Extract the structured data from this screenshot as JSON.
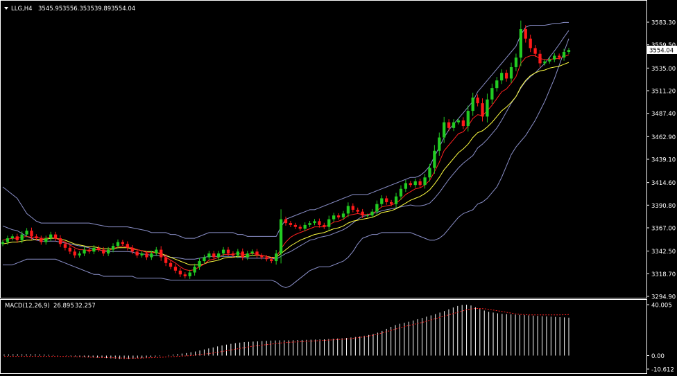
{
  "header": {
    "symbol_timeframe": "LLG,H4",
    "open": "3545.95",
    "high": "3556.35",
    "low": "3539.89",
    "close": "3554.04"
  },
  "macd_header": {
    "label": "MACD(12,26,9)",
    "main": "26.895",
    "signal": "32.257"
  },
  "current_price_label": "3554.04",
  "colors": {
    "background": "#000000",
    "bull_candle": "#22cc22",
    "bear_candle": "#ff1a1a",
    "bollinger": "#8a8fc8",
    "ma_fast": "#ff2020",
    "ma_slow": "#ffff40",
    "macd_hist": "#ffffff",
    "macd_signal": "#ff2020",
    "axis_text": "#ffffff"
  },
  "chart_data": [
    {
      "type": "candlestick",
      "title": "",
      "y_ticks": [
        "3583.30",
        "3559.50",
        "3535.00",
        "3511.20",
        "3487.40",
        "3462.90",
        "3439.10",
        "3414.60",
        "3390.80",
        "3367.00",
        "3342.50",
        "3318.70",
        "3294.90"
      ],
      "ylim": [
        3294.9,
        3583.3
      ],
      "close": [
        3352,
        3356,
        3358,
        3354,
        3360,
        3364,
        3358,
        3356,
        3352,
        3356,
        3360,
        3356,
        3350,
        3346,
        3342,
        3338,
        3340,
        3344,
        3342,
        3346,
        3344,
        3340,
        3344,
        3348,
        3352,
        3350,
        3346,
        3342,
        3338,
        3340,
        3336,
        3340,
        3344,
        3336,
        3330,
        3326,
        3322,
        3318,
        3316,
        3320,
        3326,
        3332,
        3336,
        3340,
        3336,
        3340,
        3344,
        3340,
        3338,
        3342,
        3336,
        3340,
        3342,
        3338,
        3336,
        3334,
        3332,
        3340,
        3376,
        3372,
        3370,
        3368,
        3366,
        3370,
        3372,
        3374,
        3370,
        3368,
        3376,
        3380,
        3378,
        3382,
        3390,
        3386,
        3384,
        3380,
        3380,
        3384,
        3392,
        3398,
        3394,
        3392,
        3400,
        3408,
        3414,
        3412,
        3416,
        3412,
        3420,
        3430,
        3448,
        3462,
        3478,
        3472,
        3478,
        3480,
        3474,
        3490,
        3504,
        3498,
        3484,
        3502,
        3514,
        3522,
        3530,
        3524,
        3536,
        3546,
        3576,
        3566,
        3556,
        3550,
        3540,
        3542,
        3544,
        3548,
        3546,
        3552,
        3554
      ],
      "ma_fast": [
        3354,
        3355,
        3356,
        3356,
        3357,
        3358,
        3357,
        3357,
        3356,
        3356,
        3357,
        3356,
        3354,
        3352,
        3349,
        3346,
        3344,
        3344,
        3343,
        3344,
        3344,
        3343,
        3343,
        3345,
        3347,
        3348,
        3347,
        3346,
        3344,
        3343,
        3341,
        3341,
        3341,
        3339,
        3336,
        3333,
        3330,
        3326,
        3323,
        3322,
        3323,
        3326,
        3329,
        3333,
        3334,
        3336,
        3339,
        3339,
        3339,
        3340,
        3339,
        3339,
        3340,
        3339,
        3338,
        3337,
        3335,
        3336,
        3345,
        3352,
        3357,
        3360,
        3362,
        3364,
        3366,
        3368,
        3368,
        3368,
        3370,
        3373,
        3374,
        3376,
        3380,
        3381,
        3382,
        3381,
        3381,
        3382,
        3385,
        3389,
        3390,
        3391,
        3393,
        3397,
        3402,
        3405,
        3408,
        3409,
        3412,
        3417,
        3426,
        3436,
        3448,
        3454,
        3460,
        3466,
        3468,
        3474,
        3482,
        3486,
        3485,
        3490,
        3496,
        3503,
        3510,
        3513,
        3519,
        3526,
        3540,
        3546,
        3548,
        3548,
        3545,
        3544,
        3544,
        3545,
        3545,
        3547,
        3549
      ],
      "ma_slow": [
        3350,
        3351,
        3352,
        3352,
        3353,
        3354,
        3354,
        3355,
        3355,
        3355,
        3356,
        3356,
        3355,
        3354,
        3352,
        3350,
        3349,
        3348,
        3347,
        3347,
        3346,
        3345,
        3345,
        3345,
        3346,
        3346,
        3346,
        3345,
        3344,
        3343,
        3342,
        3342,
        3341,
        3340,
        3338,
        3336,
        3334,
        3332,
        3330,
        3328,
        3328,
        3328,
        3329,
        3331,
        3332,
        3333,
        3335,
        3336,
        3336,
        3337,
        3337,
        3337,
        3338,
        3338,
        3338,
        3337,
        3336,
        3336,
        3340,
        3344,
        3348,
        3351,
        3354,
        3356,
        3358,
        3360,
        3361,
        3362,
        3364,
        3366,
        3367,
        3369,
        3372,
        3374,
        3375,
        3376,
        3377,
        3378,
        3380,
        3383,
        3384,
        3385,
        3387,
        3390,
        3393,
        3396,
        3398,
        3400,
        3403,
        3407,
        3413,
        3420,
        3428,
        3434,
        3440,
        3446,
        3450,
        3455,
        3462,
        3467,
        3469,
        3473,
        3478,
        3484,
        3490,
        3494,
        3499,
        3505,
        3515,
        3522,
        3527,
        3530,
        3532,
        3533,
        3535,
        3536,
        3537,
        3539,
        3541
      ],
      "bb_upper": [
        3410,
        3406,
        3402,
        3398,
        3390,
        3382,
        3378,
        3374,
        3372,
        3372,
        3372,
        3372,
        3372,
        3372,
        3372,
        3372,
        3372,
        3372,
        3372,
        3371,
        3370,
        3369,
        3368,
        3368,
        3368,
        3368,
        3368,
        3367,
        3366,
        3365,
        3364,
        3362,
        3362,
        3362,
        3362,
        3360,
        3360,
        3358,
        3356,
        3356,
        3356,
        3358,
        3360,
        3362,
        3362,
        3362,
        3362,
        3362,
        3362,
        3360,
        3360,
        3358,
        3358,
        3358,
        3358,
        3358,
        3358,
        3358,
        3368,
        3376,
        3378,
        3380,
        3382,
        3384,
        3386,
        3386,
        3388,
        3390,
        3392,
        3394,
        3396,
        3398,
        3400,
        3402,
        3402,
        3402,
        3402,
        3404,
        3406,
        3408,
        3410,
        3412,
        3414,
        3416,
        3418,
        3420,
        3420,
        3422,
        3426,
        3432,
        3442,
        3452,
        3462,
        3470,
        3476,
        3482,
        3488,
        3494,
        3500,
        3510,
        3516,
        3522,
        3528,
        3534,
        3540,
        3546,
        3552,
        3558,
        3570,
        3578,
        3580,
        3580,
        3580,
        3580,
        3581,
        3582,
        3582,
        3583,
        3583
      ],
      "bb_lower": [
        3328,
        3328,
        3328,
        3330,
        3332,
        3334,
        3334,
        3334,
        3334,
        3334,
        3334,
        3334,
        3332,
        3330,
        3328,
        3326,
        3324,
        3322,
        3320,
        3318,
        3318,
        3316,
        3316,
        3316,
        3316,
        3316,
        3316,
        3316,
        3314,
        3314,
        3314,
        3314,
        3314,
        3314,
        3313,
        3312,
        3312,
        3312,
        3312,
        3312,
        3312,
        3312,
        3312,
        3312,
        3312,
        3312,
        3312,
        3312,
        3312,
        3312,
        3312,
        3312,
        3312,
        3312,
        3312,
        3312,
        3312,
        3310,
        3306,
        3304,
        3306,
        3310,
        3314,
        3318,
        3322,
        3324,
        3326,
        3326,
        3326,
        3328,
        3330,
        3332,
        3336,
        3342,
        3350,
        3356,
        3358,
        3360,
        3360,
        3362,
        3362,
        3362,
        3362,
        3362,
        3362,
        3362,
        3360,
        3358,
        3356,
        3354,
        3354,
        3356,
        3360,
        3366,
        3372,
        3378,
        3382,
        3384,
        3386,
        3392,
        3394,
        3398,
        3404,
        3410,
        3420,
        3432,
        3444,
        3452,
        3458,
        3464,
        3472,
        3480,
        3490,
        3500,
        3512,
        3524,
        3538,
        3552,
        3566
      ]
    },
    {
      "type": "bar",
      "title": "MACD(12,26,9)",
      "y_ticks": [
        "40.005",
        "0.00",
        "-10.612"
      ],
      "ylim": [
        -10.612,
        40.005
      ],
      "series": [
        {
          "name": "MACD",
          "values": [
            0.8,
            0.9,
            1.0,
            1.0,
            1.0,
            1.0,
            1.0,
            1.0,
            0.9,
            0.8,
            0.6,
            0.4,
            0.2,
            0.0,
            -0.2,
            -0.4,
            -0.6,
            -0.8,
            -1.0,
            -1.2,
            -1.4,
            -1.6,
            -1.8,
            -2.0,
            -2.2,
            -2.4,
            -2.6,
            -2.6,
            -2.6,
            -2.4,
            -2.2,
            -2.0,
            -1.6,
            -1.2,
            -0.8,
            -0.4,
            0.0,
            0.4,
            0.8,
            1.2,
            1.6,
            2.0,
            2.6,
            3.2,
            4.0,
            4.8,
            5.6,
            6.4,
            7.2,
            8.0,
            8.6,
            9.2,
            9.8,
            10.2,
            10.6,
            10.8,
            11.0,
            11.2,
            11.4,
            11.6,
            11.8,
            11.9,
            12.0,
            12.0,
            12.0,
            12.1,
            12.2,
            12.3,
            12.4,
            12.5,
            12.6,
            12.7,
            12.8,
            13.0,
            13.2,
            13.4,
            13.6,
            13.8,
            14.2,
            14.6,
            15.0,
            15.6,
            16.2,
            17.0,
            18.0,
            19.4,
            21.0,
            22.6,
            24.0,
            25.0,
            25.8,
            26.6,
            27.6,
            28.6,
            29.6,
            30.6,
            31.6,
            32.6,
            33.8,
            35.0,
            36.4,
            37.8,
            39.0,
            39.8,
            40.0,
            39.4,
            38.0,
            36.6,
            35.4,
            34.4,
            33.8,
            33.2,
            32.8,
            32.6,
            32.4,
            32.2,
            32.0,
            31.8,
            31.6,
            31.4,
            31.2,
            31.0,
            30.8,
            30.6,
            30.4,
            30.2,
            30.0,
            29.8
          ]
        },
        {
          "name": "Signal",
          "values": [
            -0.6,
            -0.6,
            -0.6,
            -0.6,
            -0.6,
            -0.6,
            -0.6,
            -0.6,
            -0.6,
            -0.6,
            -0.6,
            -0.6,
            -0.6,
            -0.6,
            -0.7,
            -0.8,
            -0.9,
            -1.0,
            -1.1,
            -1.2,
            -1.3,
            -1.4,
            -1.5,
            -1.6,
            -1.7,
            -1.8,
            -1.9,
            -2.0,
            -2.0,
            -2.0,
            -2.0,
            -1.9,
            -1.8,
            -1.7,
            -1.6,
            -1.4,
            -1.2,
            -1.0,
            -0.8,
            -0.6,
            -0.4,
            -0.2,
            0.0,
            0.4,
            0.8,
            1.2,
            1.6,
            2.0,
            2.6,
            3.2,
            3.8,
            4.4,
            5.0,
            5.6,
            6.2,
            6.8,
            7.4,
            7.8,
            8.2,
            8.6,
            9.0,
            9.4,
            9.8,
            10.2,
            10.4,
            10.6,
            10.8,
            11.0,
            11.2,
            11.4,
            11.6,
            11.8,
            12.0,
            12.2,
            12.4,
            12.6,
            12.8,
            13.0,
            13.4,
            13.8,
            14.2,
            14.8,
            15.4,
            16.0,
            16.8,
            17.8,
            18.8,
            19.8,
            20.8,
            21.8,
            22.8,
            23.6,
            24.4,
            25.2,
            26.0,
            27.0,
            28.0,
            29.0,
            30.0,
            31.0,
            32.0,
            33.0,
            34.0,
            35.0,
            36.0,
            36.6,
            37.0,
            37.0,
            36.8,
            36.4,
            35.8,
            35.2,
            34.6,
            34.0,
            33.4,
            32.8,
            32.4,
            32.2,
            32.0,
            32.0,
            32.0,
            32.0,
            32.0,
            32.0,
            32.0,
            32.0,
            32.1,
            32.2
          ]
        }
      ]
    }
  ]
}
